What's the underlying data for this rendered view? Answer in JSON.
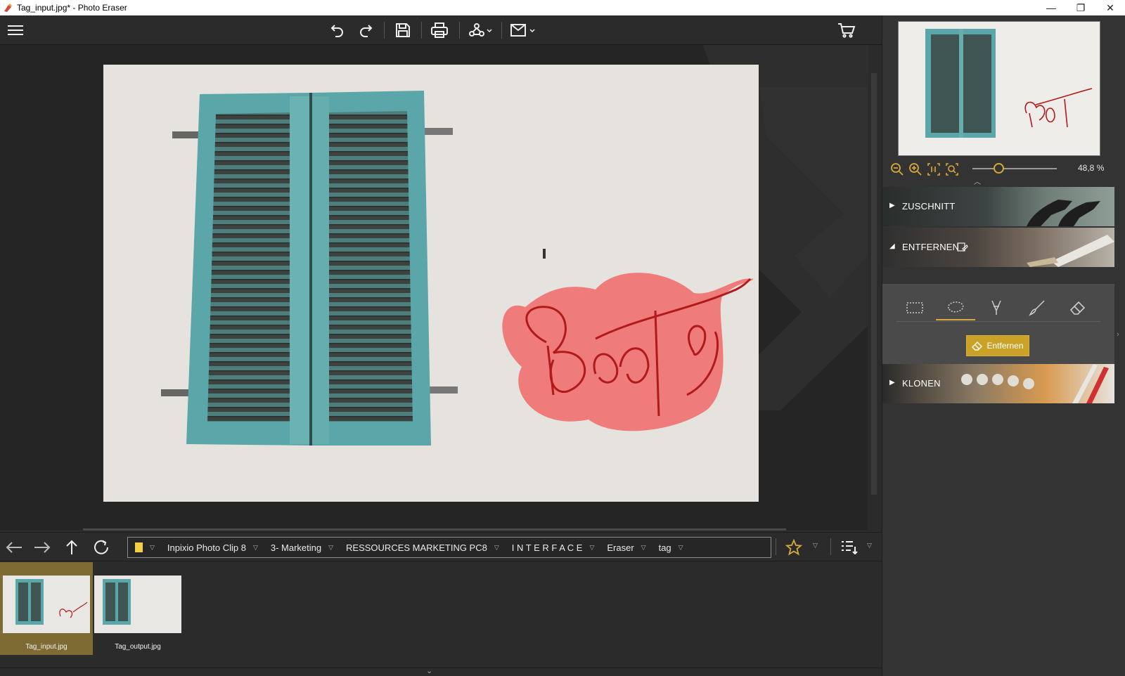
{
  "window": {
    "title": "Tag_input.jpg* - Photo Eraser",
    "minimize": "—",
    "maximize": "❐",
    "close": "✕"
  },
  "toolbar": {
    "menu_icon": "hamburger-icon",
    "undo_icon": "undo-icon",
    "redo_icon": "redo-icon",
    "save_icon": "save-icon",
    "print_icon": "print-icon",
    "share_icon": "share-icon",
    "export_icon": "export-icon",
    "cart_icon": "cart-icon"
  },
  "image": {
    "graffiti_text": "BaaT",
    "mask_color": "#f07070",
    "shutter_color": "#5aa6a8",
    "wall_color": "#e8e6e2"
  },
  "navigation": {
    "back_icon": "arrow-left-icon",
    "forward_icon": "arrow-right-icon",
    "up_icon": "arrow-up-icon",
    "refresh_icon": "refresh-icon",
    "breadcrumb": [
      {
        "label": ""
      },
      {
        "label": "Inpixio Photo Clip 8"
      },
      {
        "label": "3- Marketing"
      },
      {
        "label": "RESSOURCES MARKETING PC8"
      },
      {
        "label": "I N T E R F A C E"
      },
      {
        "label": "Eraser"
      },
      {
        "label": "tag"
      }
    ],
    "favorite_icon": "star-icon",
    "sort_icon": "sort-list-icon"
  },
  "filmstrip": [
    {
      "label": "Tag_input.jpg",
      "selected": true
    },
    {
      "label": "Tag_output.jpg",
      "selected": false
    }
  ],
  "rightpanel": {
    "zoom": {
      "out_icon": "zoom-out-icon",
      "in_icon": "zoom-in-icon",
      "actual_icon": "actual-size-icon",
      "fit_icon": "fit-screen-icon",
      "value": "48,8 %",
      "level": 0.3
    },
    "sections": [
      {
        "label": "ZUSCHNITT",
        "expanded": false
      },
      {
        "label": "ENTFERNEN",
        "expanded": true
      },
      {
        "label": "KLONEN",
        "expanded": false
      }
    ],
    "tools": [
      {
        "name": "rectangle-select-icon",
        "active": false
      },
      {
        "name": "lasso-select-icon",
        "active": true
      },
      {
        "name": "pen-select-icon",
        "active": false
      },
      {
        "name": "brush-icon",
        "active": false
      },
      {
        "name": "eraser-icon",
        "active": false
      }
    ],
    "remove_button": "Entfernen",
    "accent": "#d9a83c"
  }
}
